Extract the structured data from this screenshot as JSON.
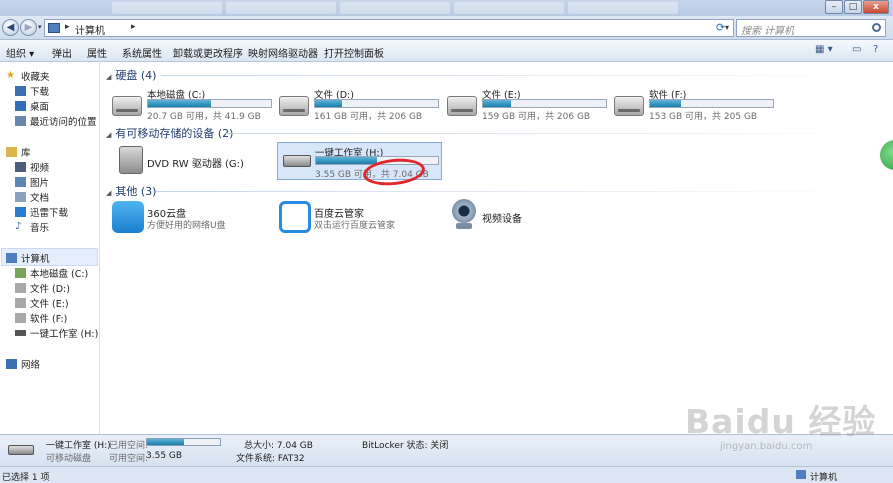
{
  "window": {
    "min": "–",
    "max": "□",
    "close": "x"
  },
  "address": {
    "path": "计算机",
    "separator": "▸",
    "search_placeholder": "搜索 计算机"
  },
  "toolbar": {
    "organize": "组织 ▾",
    "eject": "弹出",
    "properties": "属性",
    "system_properties": "系统属性",
    "uninstall": "卸载或更改程序",
    "map_drive": "映射网络驱动器",
    "control_panel": "打开控制面板",
    "view_options": "▦ ▾",
    "help": "?"
  },
  "nav": {
    "favorites": "收藏夹",
    "downloads": "下载",
    "desktop": "桌面",
    "recent": "最近访问的位置",
    "libraries": "库",
    "videos": "视频",
    "pictures": "图片",
    "documents": "文档",
    "thunder": "迅雷下载",
    "music": "音乐",
    "computer": "计算机",
    "drive_c": "本地磁盘 (C:)",
    "drive_d": "文件 (D:)",
    "drive_e": "文件 (E:)",
    "drive_f": "软件 (F:)",
    "drive_h": "一键工作室 (H:)",
    "network": "网络"
  },
  "groups": {
    "hard_disks": "硬盘 (4)",
    "removable": "有可移动存储的设备 (2)",
    "other": "其他 (3)"
  },
  "drives": [
    {
      "name": "本地磁盘 (C:)",
      "free": "20.7 GB 可用，共 41.9 GB",
      "used_fraction": 0.51
    },
    {
      "name": "文件 (D:)",
      "free": "161 GB 可用，共 206 GB",
      "used_fraction": 0.22
    },
    {
      "name": "文件 (E:)",
      "free": "159 GB 可用，共 206 GB",
      "used_fraction": 0.23
    },
    {
      "name": "软件 (F:)",
      "free": "153 GB 可用，共 205 GB",
      "used_fraction": 0.25
    }
  ],
  "removable": {
    "dvd": "DVD RW 驱动器 (G:)",
    "usb_name": "一键工作室 (H:)",
    "usb_free": "3.55 GB 可用，共 7.04 GB",
    "usb_used_fraction": 0.5
  },
  "other_items": {
    "cloud360": "360云盘",
    "cloud360_sub": "方便好用的网络U盘",
    "baidu": "百度云管家",
    "baidu_sub": "双击运行百度云管家",
    "camera": "视频设备"
  },
  "details": {
    "name": "一键工作室 (H:)",
    "type": "可移动磁盘",
    "used_label": "已用空间:",
    "free_label": "可用空间:",
    "free_value": "3.55 GB",
    "total": "总大小: 7.04 GB",
    "fs": "文件系统: FAT32",
    "bitlocker": "BitLocker 状态: 关闭",
    "used_fraction": 0.5
  },
  "status": {
    "selected": "已选择 1 项",
    "location": "计算机"
  },
  "watermark": {
    "logo": "Baidu 经验",
    "url": "jingyan.baidu.com"
  }
}
